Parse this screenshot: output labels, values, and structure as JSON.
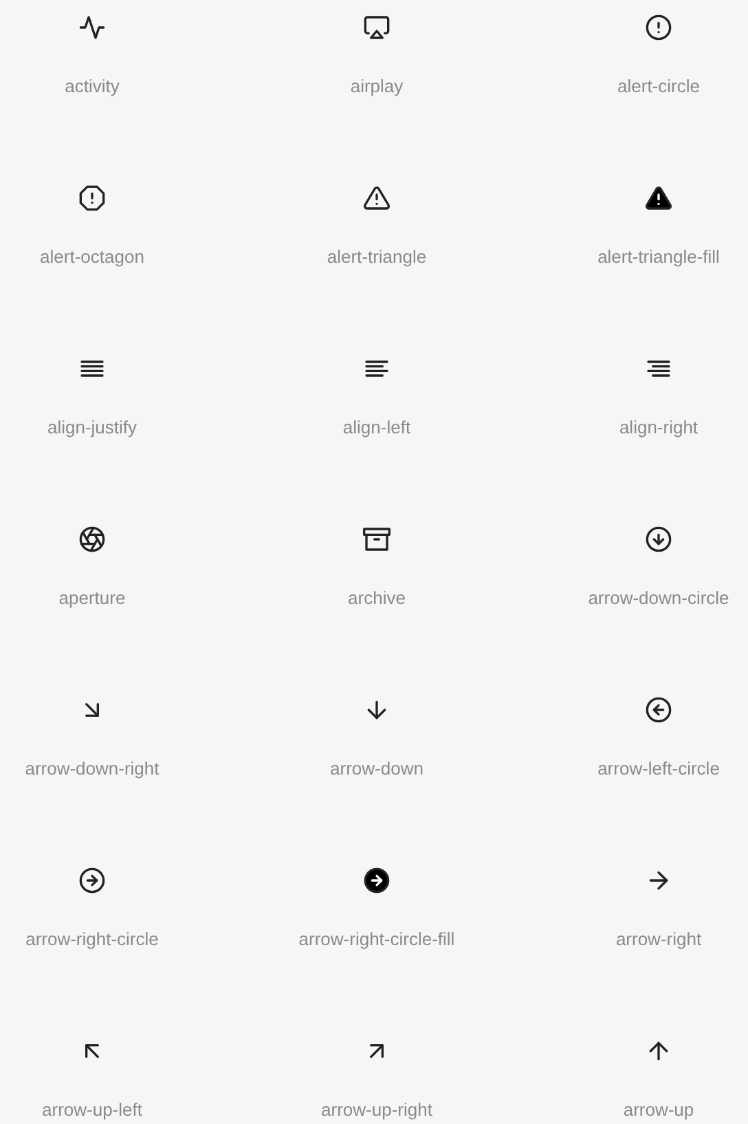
{
  "icons": [
    {
      "label": "activity"
    },
    {
      "label": "airplay"
    },
    {
      "label": "alert-circle"
    },
    {
      "label": "alert-octagon"
    },
    {
      "label": "alert-triangle"
    },
    {
      "label": "alert-triangle-fill"
    },
    {
      "label": "align-justify"
    },
    {
      "label": "align-left"
    },
    {
      "label": "align-right"
    },
    {
      "label": "aperture"
    },
    {
      "label": "archive"
    },
    {
      "label": "arrow-down-circle"
    },
    {
      "label": "arrow-down-right"
    },
    {
      "label": "arrow-down"
    },
    {
      "label": "arrow-left-circle"
    },
    {
      "label": "arrow-right-circle"
    },
    {
      "label": "arrow-right-circle-fill"
    },
    {
      "label": "arrow-right"
    },
    {
      "label": "arrow-up-left"
    },
    {
      "label": "arrow-up-right"
    },
    {
      "label": "arrow-up"
    }
  ]
}
